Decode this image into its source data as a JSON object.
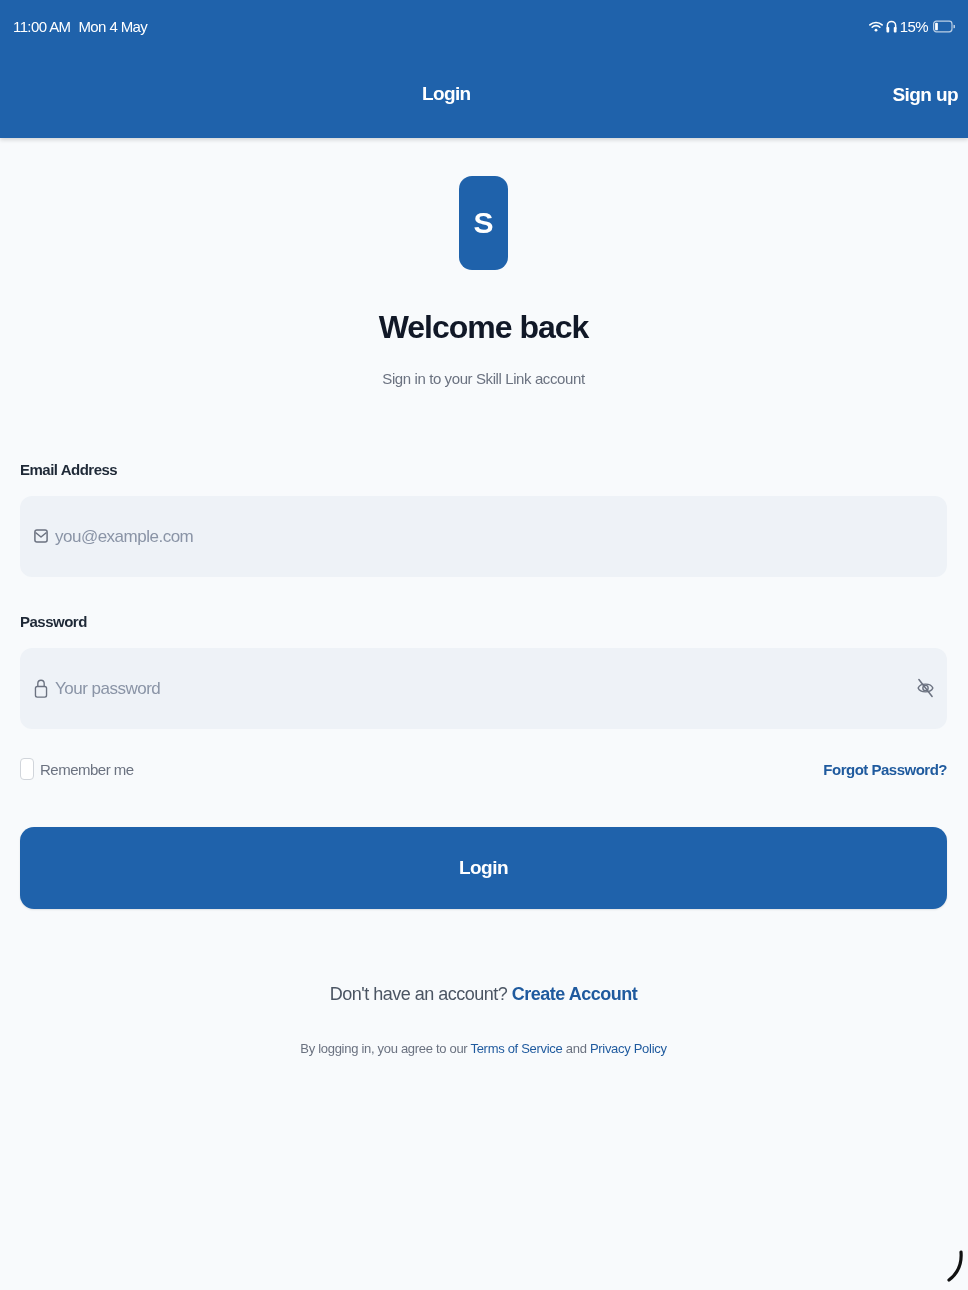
{
  "status_bar": {
    "time": "11:00 AM",
    "date": "Mon 4 May",
    "battery": "15%"
  },
  "nav_bar": {
    "title": "Login",
    "action": "Sign up"
  },
  "logo": {
    "letter": "S"
  },
  "heading": {
    "title": "Welcome back",
    "subtitle": "Sign in to your Skill Link account"
  },
  "form": {
    "fields": [
      {
        "kind": "email",
        "label": "Email Address",
        "placeholder": "you@example.com"
      },
      {
        "kind": "password",
        "label": "Password",
        "placeholder": "Your password"
      }
    ],
    "remember": {
      "label": "Remember me",
      "checked": false
    },
    "forgot": "Forgot Password?",
    "submit": "Login"
  },
  "signup_prompt": {
    "text": "Don't have an account?",
    "link": "Create Account"
  },
  "legal": {
    "parts": [
      {
        "kind": "text",
        "text": "By logging in, you agree to our"
      },
      {
        "kind": "link",
        "text": "Terms of Service"
      },
      {
        "kind": "text",
        "text": "and"
      },
      {
        "kind": "link",
        "text": "Privacy Policy"
      }
    ]
  }
}
